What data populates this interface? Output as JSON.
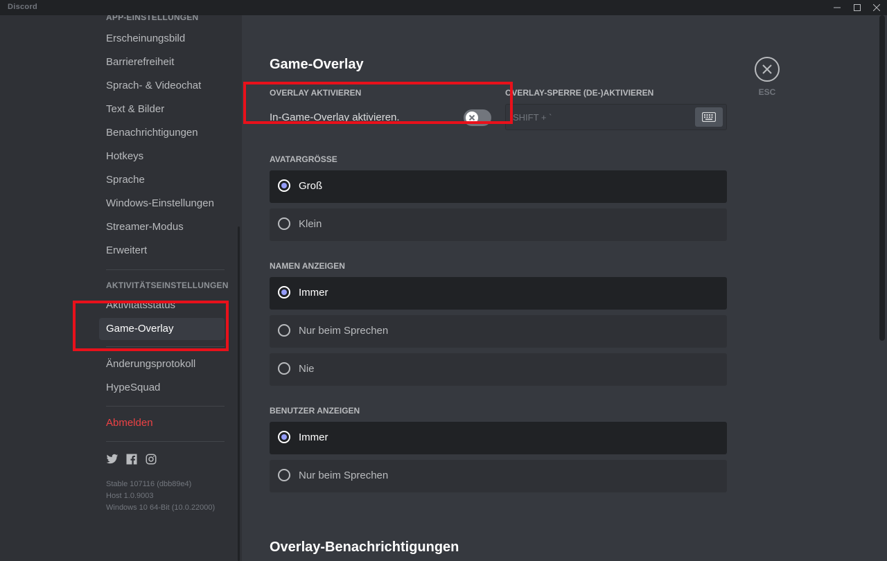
{
  "window": {
    "app_name": "Discord"
  },
  "sidebar": {
    "app_settings_header": "APP-EINSTELLUNGEN",
    "app_items": [
      {
        "label": "Erscheinungsbild"
      },
      {
        "label": "Barrierefreiheit"
      },
      {
        "label": "Sprach- & Videochat"
      },
      {
        "label": "Text & Bilder"
      },
      {
        "label": "Benachrichtigungen"
      },
      {
        "label": "Hotkeys"
      },
      {
        "label": "Sprache"
      },
      {
        "label": "Windows-Einstellungen"
      },
      {
        "label": "Streamer-Modus"
      },
      {
        "label": "Erweitert"
      }
    ],
    "activity_header": "AKTIVITÄTSEINSTELLUNGEN",
    "activity_items": [
      {
        "label": "Aktivitätsstatus"
      },
      {
        "label": "Game-Overlay",
        "selected": true
      }
    ],
    "other_items": [
      {
        "label": "Änderungsprotokoll"
      },
      {
        "label": "HypeSquad"
      }
    ],
    "logout_label": "Abmelden",
    "social_icons": [
      "twitter-icon",
      "facebook-icon",
      "instagram-icon"
    ],
    "version": {
      "stable": "Stable 107116 (dbb89e4)",
      "host": "Host 1.0.9003",
      "os": "Windows 10 64-Bit (10.0.22000)"
    }
  },
  "main": {
    "title": "Game-Overlay",
    "overlay_enable_label": "OVERLAY AKTIVIEREN",
    "overlay_toggle_text": "In-Game-Overlay aktivieren.",
    "overlay_toggle_on": false,
    "lock_label": "OVERLAY-SPERRE (DE-)AKTIVIEREN",
    "lock_keybind": "SHIFT + `",
    "avatar_size_label": "AVATARGRÖSSE",
    "avatar_options": [
      {
        "label": "Groß",
        "checked": true
      },
      {
        "label": "Klein",
        "checked": false
      }
    ],
    "names_label": "NAMEN ANZEIGEN",
    "names_options": [
      {
        "label": "Immer",
        "checked": true
      },
      {
        "label": "Nur beim Sprechen",
        "checked": false
      },
      {
        "label": "Nie",
        "checked": false
      }
    ],
    "users_label": "BENUTZER ANZEIGEN",
    "users_options": [
      {
        "label": "Immer",
        "checked": true
      },
      {
        "label": "Nur beim Sprechen",
        "checked": false
      }
    ],
    "notifications_title": "Overlay-Benachrichtigungen",
    "esc_label": "ESC"
  },
  "colors": {
    "accent": "#949cf7",
    "highlight": "#e8111b",
    "danger": "#ed4245"
  }
}
